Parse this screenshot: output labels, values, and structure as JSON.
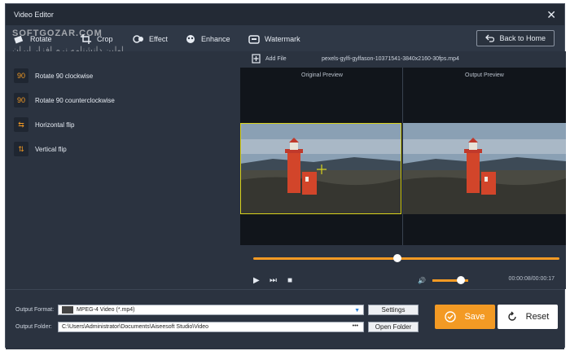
{
  "window": {
    "title": "Video Editor",
    "close_glyph": "✕"
  },
  "toolbar": {
    "tabs": [
      {
        "label": "Rotate",
        "icon": "rotate-icon"
      },
      {
        "label": "Crop",
        "icon": "crop-icon"
      },
      {
        "label": "Effect",
        "icon": "effect-icon"
      },
      {
        "label": "Enhance",
        "icon": "enhance-icon"
      },
      {
        "label": "Watermark",
        "icon": "watermark-icon"
      }
    ],
    "back_label": "Back to Home"
  },
  "watermark": {
    "logo_text": "SOFTGOZAR.COM",
    "tagline": "اولین دانشنامه نرم افزار ایران"
  },
  "rotate_options": [
    {
      "label": "Rotate 90 clockwise",
      "glyph": "90",
      "icon": "rotate-cw-icon"
    },
    {
      "label": "Rotate 90 counterclockwise",
      "glyph": "90",
      "icon": "rotate-ccw-icon"
    },
    {
      "label": "Horizontal flip",
      "glyph": "⇆",
      "icon": "flip-horizontal-icon"
    },
    {
      "label": "Vertical flip",
      "glyph": "⇅",
      "icon": "flip-vertical-icon"
    }
  ],
  "file_bar": {
    "add_label": "Add File",
    "filename": "pexels-gylfi-gylfason-10371541-3840x2160-30fps.mp4"
  },
  "preview": {
    "original_label": "Original Preview",
    "output_label": "Output Preview"
  },
  "playback": {
    "progress": 0.47,
    "volume": 0.8,
    "time": "00:00:08/00:00:17",
    "play_glyph": "▶",
    "next_glyph": "⏭",
    "stop_glyph": "■",
    "volume_glyph": "🔊"
  },
  "output": {
    "format_label": "Output Format:",
    "format_value": "MPEG-4 Video (*.mp4)",
    "settings_label": "Settings",
    "folder_label": "Output Folder:",
    "folder_value": "C:\\Users\\Administrator\\Documents\\Aiseesoft Studio\\Video",
    "folder_dots": "•••",
    "open_folder_label": "Open Folder"
  },
  "actions": {
    "save_label": "Save",
    "reset_label": "Reset"
  },
  "colors": {
    "accent": "#f39a24",
    "crop_frame": "#d9d21c",
    "panel": "#2b3340"
  }
}
